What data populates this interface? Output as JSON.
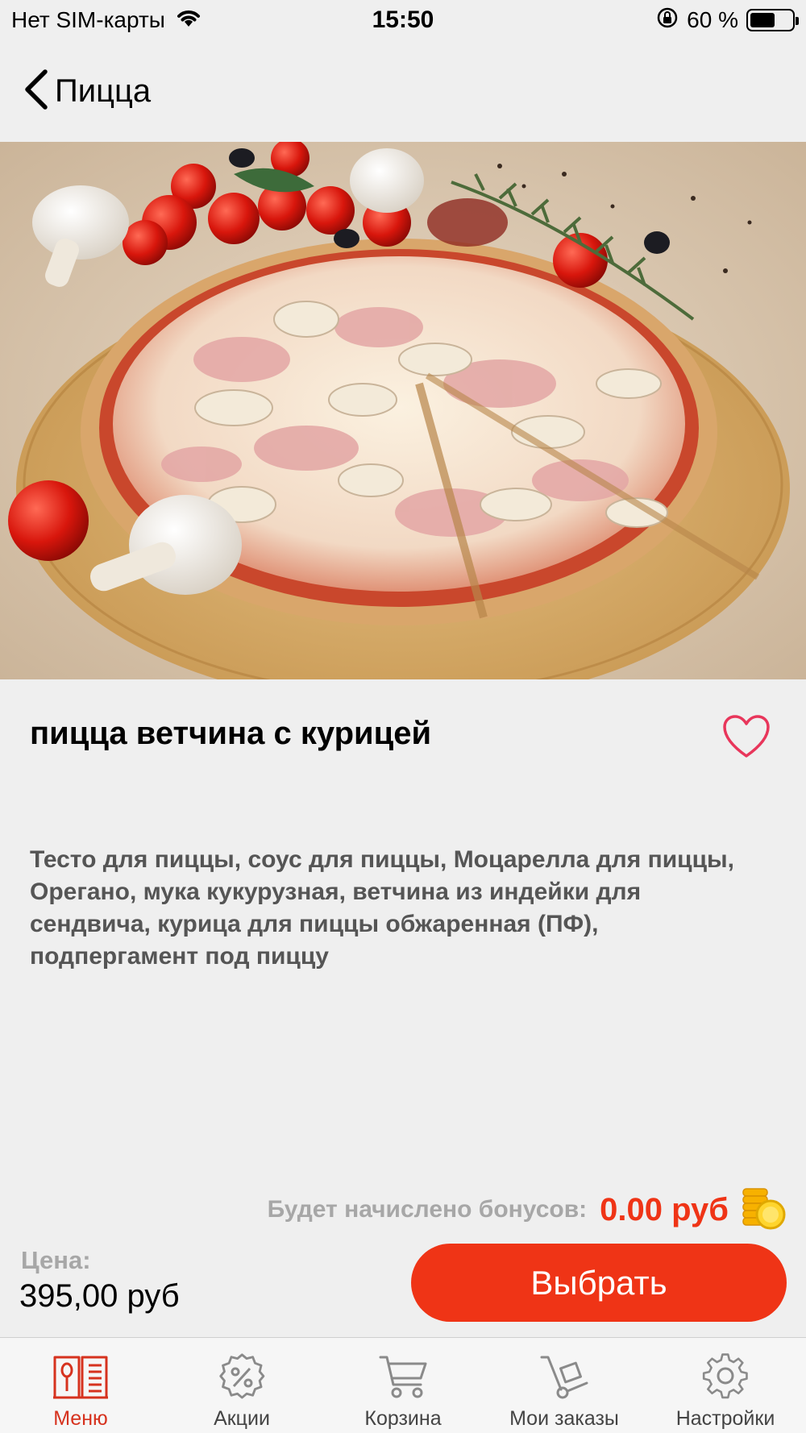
{
  "status_bar": {
    "carrier": "Нет SIM-карты",
    "time": "15:50",
    "battery": "60 %"
  },
  "nav": {
    "back_label": "Пицца"
  },
  "product": {
    "image_icon": "pizza-photo",
    "title": "пицца ветчина с курицей",
    "description": "Тесто для пиццы, соус для пиццы, Моцарелла для пиццы, Орегано, мука кукурузная, ветчина из индейки для сендвича, курица для пиццы обжаренная (ПФ), подпергамент под пиццу"
  },
  "bonus": {
    "label": "Будет начислено бонусов:",
    "value": "0.00 руб"
  },
  "price": {
    "label": "Цена:",
    "value": "395,00 руб"
  },
  "actions": {
    "select_label": "Выбрать"
  },
  "tabs": [
    {
      "label": "Меню",
      "icon": "menu-book-icon",
      "active": true
    },
    {
      "label": "Акции",
      "icon": "percent-gear-icon",
      "active": false
    },
    {
      "label": "Корзина",
      "icon": "cart-icon",
      "active": false
    },
    {
      "label": "Мои заказы",
      "icon": "hand-truck-icon",
      "active": false
    },
    {
      "label": "Настройки",
      "icon": "gear-icon",
      "active": false
    }
  ],
  "colors": {
    "accent": "#ef3416",
    "tab_active": "#d6321e",
    "muted": "#a7a7a7",
    "background": "#efefef"
  }
}
